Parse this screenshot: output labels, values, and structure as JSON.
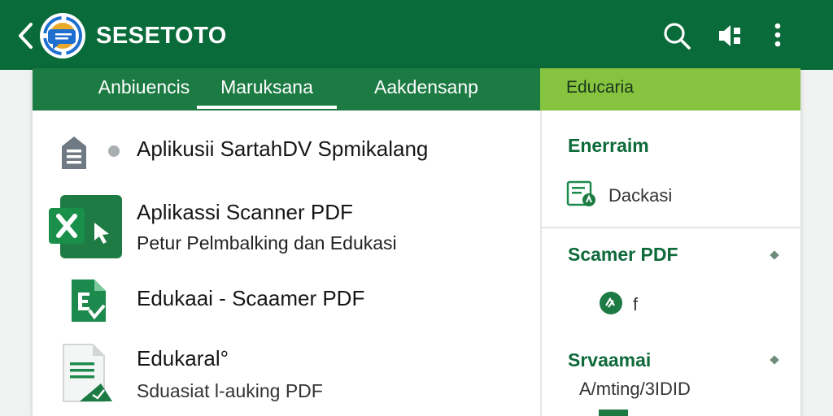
{
  "appbar": {
    "title": "SESETOTO",
    "back_icon": "chevron-left-icon",
    "logo_icon": "chat-logo-icon",
    "actions": [
      "search-icon",
      "share-icon",
      "more-vertical-icon"
    ],
    "color": "#0a6b3a"
  },
  "tabs": {
    "items": [
      {
        "label": "Anbiuencis"
      },
      {
        "label": "Maruksana"
      },
      {
        "label": "Aakdensanp"
      }
    ],
    "selected": "Maruksana",
    "side_tab": "Educaria",
    "side_tab_color": "#86c440"
  },
  "list": {
    "items": [
      {
        "title": "Aplikusii SartahDV Spmikalang",
        "subtitle": "",
        "icon": "document-stack-icon"
      },
      {
        "title": "Aplikassi Scanner PDF",
        "subtitle": "Petur Pelmbalking dan Edukasi",
        "icon": "excel-x-icon"
      },
      {
        "title": "Edukaai - Scaamer PDF",
        "subtitle": "",
        "icon": "spreadsheet-file-icon"
      },
      {
        "title": "Edukaral°",
        "subtitle": "Sduasiat l-auking PDF",
        "icon": "pdf-document-icon"
      }
    ]
  },
  "panel": {
    "section1": {
      "heading": "Enerraim",
      "item": "Dackasi"
    },
    "section2": {
      "heading": "Scamer PDF",
      "item": "f"
    },
    "section3": {
      "heading": "Srvaamai",
      "item": "A/mting/3IDID"
    }
  }
}
